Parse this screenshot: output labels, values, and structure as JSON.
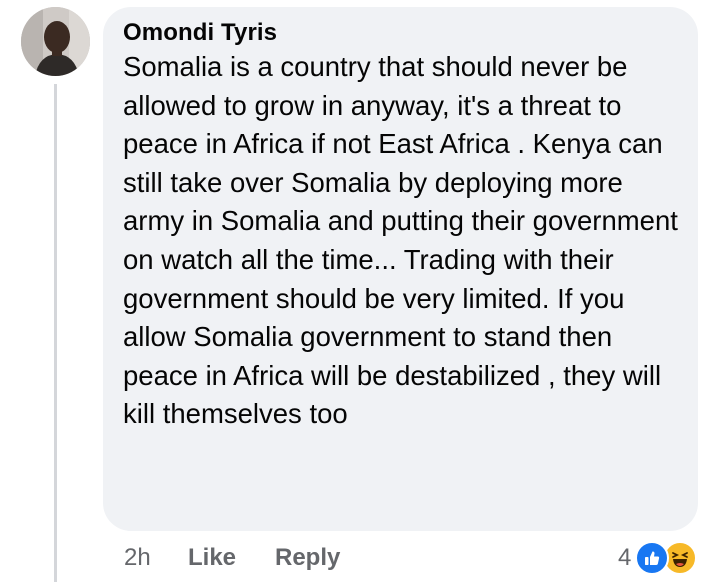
{
  "comment": {
    "author": "Omondi Tyris",
    "text": "Somalia is a country that should never be allowed to grow in anyway, it's a threat to peace in Africa if not East Africa . Kenya can still take over Somalia by deploying more army in Somalia and putting their government on watch all the time... Trading with their government should be very limited. If you allow Somalia government to stand then peace in Africa will be destabilized , they will kill themselves too",
    "time": "2h",
    "like_label": "Like",
    "reply_label": "Reply",
    "reaction_count": "4",
    "reactions": [
      "like-icon",
      "haha-icon"
    ]
  },
  "colors": {
    "bubble": "#f0f2f5",
    "meta_text": "#65676b",
    "like_blue": "#1877f2",
    "haha_yellow": "#f7b928"
  }
}
